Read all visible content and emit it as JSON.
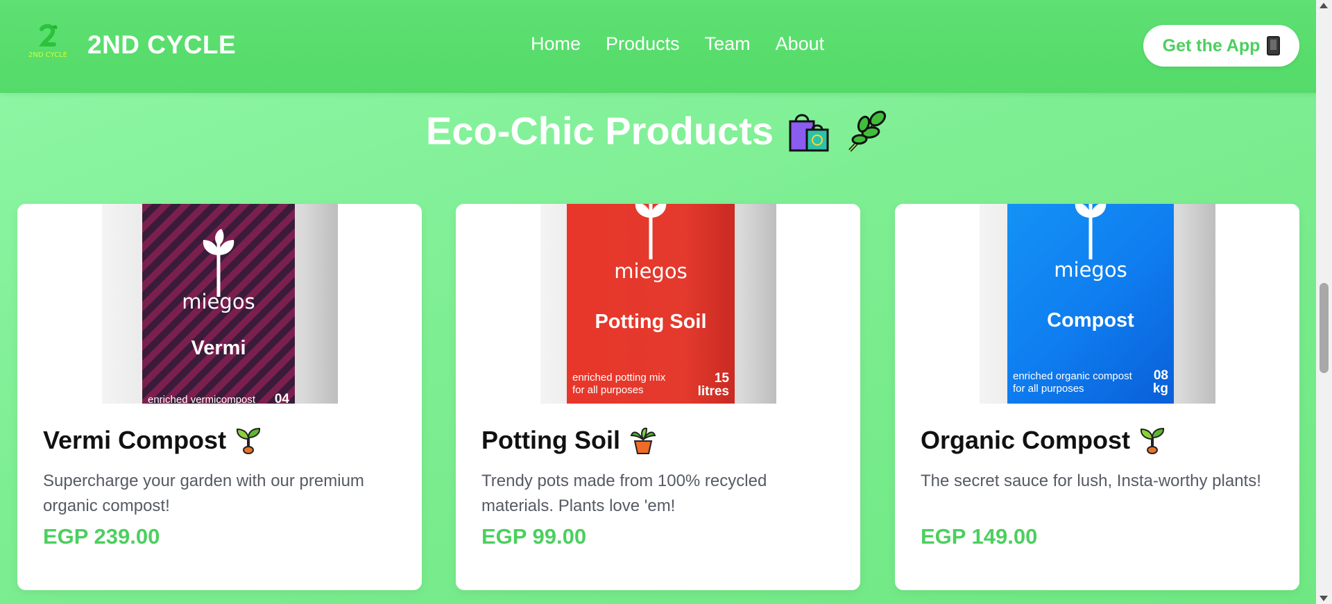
{
  "header": {
    "brand": "2ND CYCLE",
    "logo_text": "2ND CYCLE",
    "nav": [
      "Home",
      "Products",
      "Team",
      "About"
    ],
    "cta_label": "Get the App",
    "cta_icon": "phone-icon"
  },
  "section": {
    "title": "Eco-Chic Products",
    "icons": [
      "shopping-bags-icon",
      "herb-icon"
    ]
  },
  "products": [
    {
      "name": "Vermi Compost",
      "icon": "seedling-icon",
      "description": "Supercharge your garden with our premium organic compost!",
      "price": "EGP 239.00",
      "package": {
        "brand": "miegos",
        "label": "Vermi",
        "subtext": "enriched vermicompost",
        "quantity": "04",
        "color": "#7a1f4e"
      }
    },
    {
      "name": "Potting Soil",
      "icon": "potted-plant-icon",
      "description": "Trendy pots made from 100% recycled materials. Plants love 'em!",
      "price": "EGP 99.00",
      "package": {
        "brand": "miegos",
        "label": "Potting Soil",
        "subtext": "enriched potting mix for all purposes",
        "quantity": "15 litres",
        "color": "#e8362a"
      }
    },
    {
      "name": "Organic Compost",
      "icon": "seedling-icon",
      "description": "The secret sauce for lush, Insta-worthy plants!",
      "price": "EGP 149.00",
      "package": {
        "brand": "miegos",
        "label": "Compost",
        "subtext": "enriched organic compost for all purposes",
        "quantity": "08 kg",
        "color": "#0f7ef0"
      }
    }
  ],
  "colors": {
    "accent": "#4ccf5f",
    "header_bg": "#5ee072",
    "page_bg": "#7eee93"
  }
}
